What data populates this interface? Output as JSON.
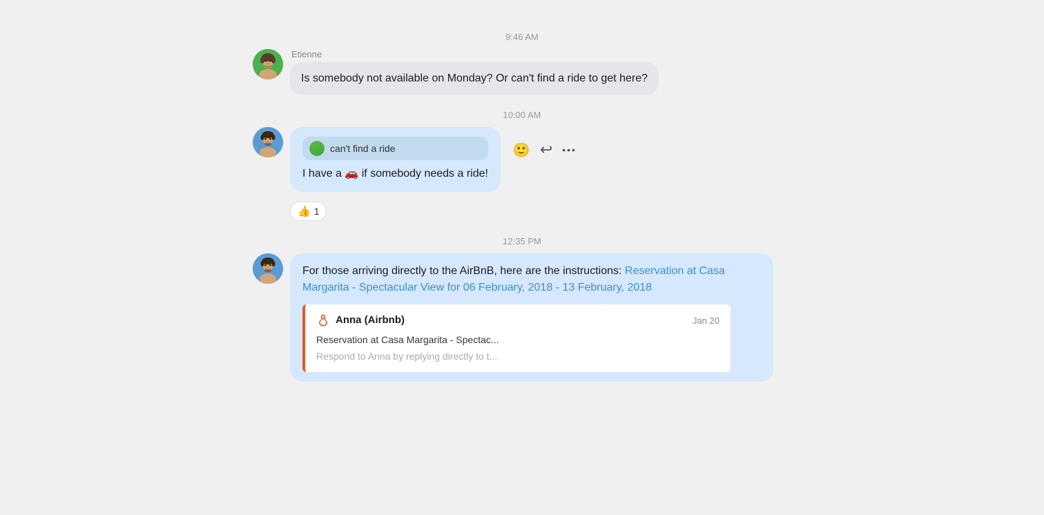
{
  "timestamps": {
    "t1": "9:46 AM",
    "t2": "10:00 AM",
    "t3": "12:35 PM"
  },
  "messages": {
    "msg1": {
      "sender": "Etienne",
      "text": "Is somebody not available on Monday? Or can't find a ride to get here?"
    },
    "msg2": {
      "reply_quote": "can't find a ride",
      "text_before": "I have a 🚗 if somebody needs a ride!",
      "reaction_emoji": "👍",
      "reaction_count": "1"
    },
    "msg3": {
      "text_before": "For those arriving directly to the AirBnB, here are the instructions: ",
      "link_text": "Reservation at Casa Margarita - Spectacular View for 06 February, 2018 - 13 February, 2018",
      "preview": {
        "sender_name": "Anna (Airbnb)",
        "date": "Jan 20",
        "subject": "Reservation at Casa Margarita - Spectac...",
        "body": "Respond to Anna by replying directly to t..."
      }
    }
  },
  "actions": {
    "emoji": "🙂",
    "reply": "↩",
    "more": "•••"
  }
}
